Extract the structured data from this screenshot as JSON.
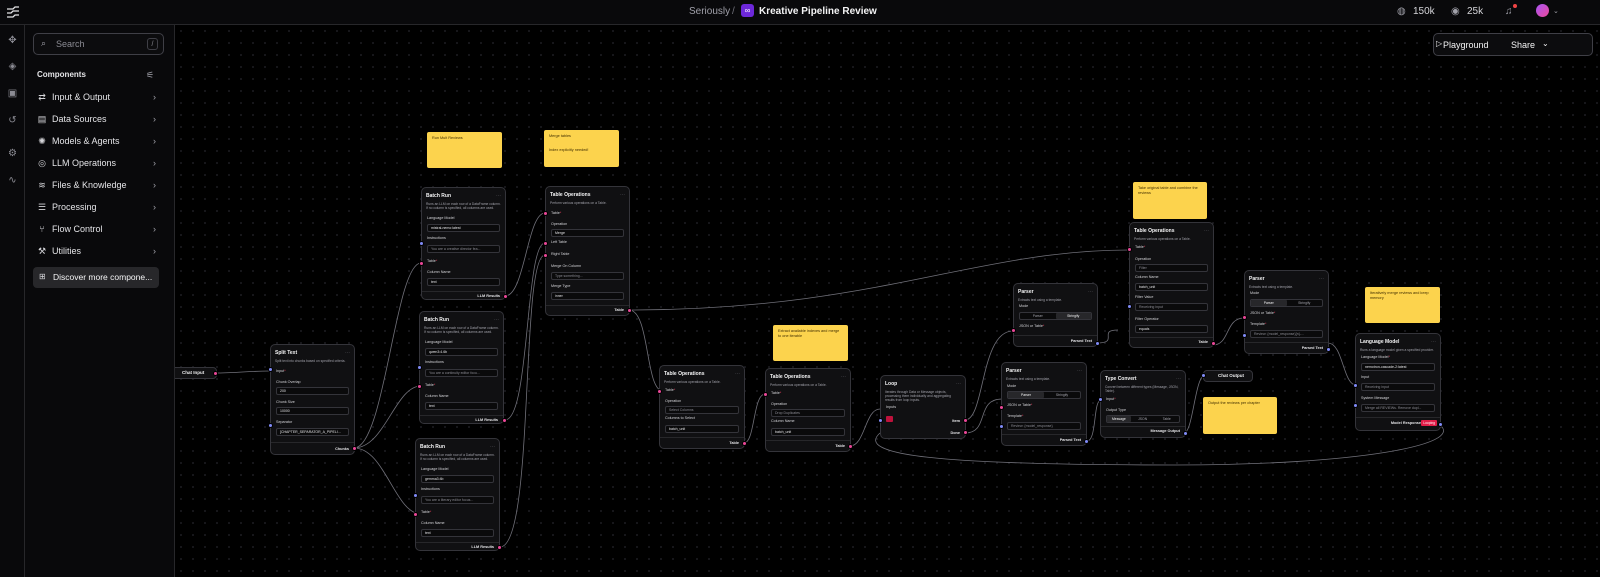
{
  "topbar": {
    "folder": "Seriously",
    "separator": "/",
    "flow_name": "Kreative Pipeline Review",
    "github_count": "150k",
    "discord_count": "25k"
  },
  "sidebar": {
    "search_placeholder": "Search",
    "search_shortcut": "/",
    "components_title": "Components",
    "categories": [
      {
        "label": "Input & Output",
        "icon": "io-icon"
      },
      {
        "label": "Data Sources",
        "icon": "database-icon"
      },
      {
        "label": "Models & Agents",
        "icon": "brain-icon"
      },
      {
        "label": "LLM Operations",
        "icon": "llm-icon"
      },
      {
        "label": "Files & Knowledge",
        "icon": "layers-icon"
      },
      {
        "label": "Processing",
        "icon": "filter-icon"
      },
      {
        "label": "Flow Control",
        "icon": "flow-icon"
      },
      {
        "label": "Utilities",
        "icon": "wrench-icon"
      }
    ],
    "discover": "Discover more compone..."
  },
  "canvas": {
    "playground": "Playground",
    "share": "Share",
    "chat_input": "Chat Input",
    "split_text": {
      "title": "Split Text",
      "desc": "Split text into chunks based on specified criteria.",
      "input": "Input",
      "overlap_label": "Chunk Overlap",
      "overlap": "200",
      "size_label": "Chunk Size",
      "size": "10000",
      "sep_label": "Separator",
      "sep": "[CHAPTER_SEPARATOR_A_PIPELI...",
      "output": "Chunks"
    },
    "batch1": {
      "title": "Batch Run",
      "desc": "Runs an LLM on each row of a DataFrame column. If no column is specified, all columns are used.",
      "model_label": "Language Model",
      "model": "mistral-nemo:latest",
      "instr_label": "Instructions",
      "instr": "You are a creative director fea...",
      "df_label": "Table",
      "col_label": "Column Name",
      "col": "text",
      "output": "LLM Results"
    },
    "batch2": {
      "title": "Batch Run",
      "desc": "Runs an LLM on each row of a DataFrame column. If no column is specified, all columns are used.",
      "model_label": "Language Model",
      "model": "qwen3:4.6b",
      "instr_label": "Instructions",
      "instr": "You are a continuity editor focu...",
      "df_label": "Table",
      "col_label": "Column Name",
      "col": "text",
      "output": "LLM Results"
    },
    "batch3": {
      "title": "Batch Run",
      "desc": "Runs an LLM on each row of a DataFrame column. If no column is specified, all columns are used.",
      "model_label": "Language Model",
      "model": "gemma3:4b",
      "instr_label": "Instructions",
      "instr": "You are a literary editor focus...",
      "df_label": "Table",
      "col_label": "Column Name",
      "col": "text",
      "output": "LLM Results"
    },
    "merge": {
      "title": "Table Operations",
      "desc": "Perform various operations on a Table.",
      "t1": "Table",
      "op_label": "Operation",
      "op": "Merge",
      "left": "Left Table",
      "right": "Right Table",
      "on_label": "Merge On Column",
      "on": "Type something...",
      "type_label": "Merge Type",
      "type": "inner",
      "output": "Table"
    },
    "sel": {
      "title": "Table Operations",
      "desc": "Perform various operations on a Table.",
      "t1": "Table",
      "op_label": "Operation",
      "op": "Select Columns",
      "cols_label": "Columns to Select",
      "cols": "batch_unit",
      "output": "Table"
    },
    "drop": {
      "title": "Table Operations",
      "desc": "Perform various operations on a Table.",
      "t1": "Table",
      "op_label": "Operation",
      "op": "Drop Duplicates",
      "col_label": "Column Name",
      "col": "batch_unit",
      "output": "Table"
    },
    "filt": {
      "title": "Table Operations",
      "desc": "Perform various operations on a Table.",
      "t1": "Table",
      "op_label": "Operation",
      "op": "Filter",
      "col_label": "Column Name",
      "col": "batch_unit",
      "fv_label": "Filter Value",
      "fv": "Receiving input",
      "fo_label": "Filter Operator",
      "fo": "equals",
      "output": "Table"
    },
    "loop": {
      "title": "Loop",
      "desc": "Iterates through Data or Message objects, processing them individually and aggregating results from loop inputs.",
      "inputs": "Inputs",
      "item": "Item",
      "done": "Done"
    },
    "parser1": {
      "title": "Parser",
      "desc": "Extracts text using a template.",
      "mode_label": "Mode",
      "m1": "Parser",
      "m2": "Stringify",
      "in_label": "JSON or Table",
      "tpl_label": "Template",
      "tpl": "Review: {model_response}",
      "output": "Parsed Text"
    },
    "parser2": {
      "title": "Parser",
      "desc": "Extracts text using a template.",
      "mode_label": "Mode",
      "m1": "Parser",
      "m2": "Stringify",
      "in_label": "JSON or Table",
      "output": "Parsed Text"
    },
    "parser3": {
      "title": "Parser",
      "desc": "Extracts text using a template.",
      "mode_label": "Mode",
      "m1": "Parser",
      "m2": "Stringify",
      "in_label": "JSON or Table",
      "tpl_label": "Template",
      "tpl": "Review: {model_response}{n}-...",
      "output": "Parsed Text"
    },
    "conv": {
      "title": "Type Convert",
      "desc": "Convert between different types (Message, JSON, Table).",
      "in_label": "Input",
      "ot_label": "Output Type",
      "o1": "Message",
      "o2": "JSON",
      "o3": "Table",
      "output": "Message Output"
    },
    "chat_output": "Chat Output",
    "llm": {
      "title": "Language Model",
      "desc": "Runs a language model given a specified provider.",
      "model_label": "Language Model",
      "model": "nemotron-cascade-2:latest",
      "in_label": "Input",
      "in": "Receiving input",
      "sys_label": "System Message",
      "sys": "Merge all REVIEWs. Remove dupl...",
      "output": "Model Response",
      "badge": "Looping"
    },
    "notes": {
      "n1": "Run Mult Reviews",
      "n2a": "Merge tables",
      "n2b": "Index explicitly needed!",
      "n3": "Extract available indexes and merge to one iterable",
      "n4": "Take original table and combine the reviews",
      "n5": "Output the reviews per chapter",
      "n6": "Iteratively merge reviews and keep memory"
    }
  },
  "colors": {
    "handle_pink": "#ec4899",
    "handle_blue": "#818cf8",
    "note_yellow": "#fcd34d",
    "badge_red": "#e11d48"
  }
}
